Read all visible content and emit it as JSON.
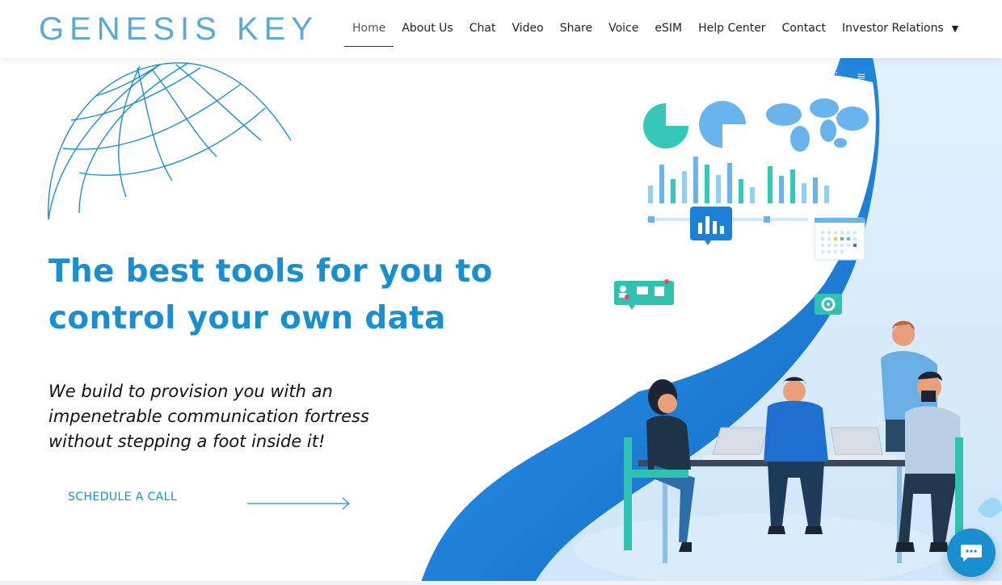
{
  "brand": {
    "logo_text": "GENESIS KEY"
  },
  "nav": {
    "items": [
      {
        "label": "Home",
        "active": true
      },
      {
        "label": "About Us"
      },
      {
        "label": "Chat"
      },
      {
        "label": "Video"
      },
      {
        "label": "Share"
      },
      {
        "label": "Voice"
      },
      {
        "label": "eSIM"
      },
      {
        "label": "Help Center"
      },
      {
        "label": "Contact"
      },
      {
        "label": "Investor Relations",
        "has_dropdown": true
      }
    ]
  },
  "hero": {
    "headline": "The best tools for you to control your own data",
    "subheadline": "We build to provision you with an impenetrable communication fortress without stepping a foot inside it!",
    "cta_label": "SCHEDULE A CALL"
  },
  "icons": {
    "fullscreen": "expand-icon",
    "menu": "menu-icon",
    "chat": "chat-bubble-icon",
    "dropdown": "caret-down-icon"
  },
  "colors": {
    "accent": "#1a8fd0",
    "logo": "#5aa9d6",
    "wave": "#1e88e5",
    "teal": "#2fc2b0"
  }
}
